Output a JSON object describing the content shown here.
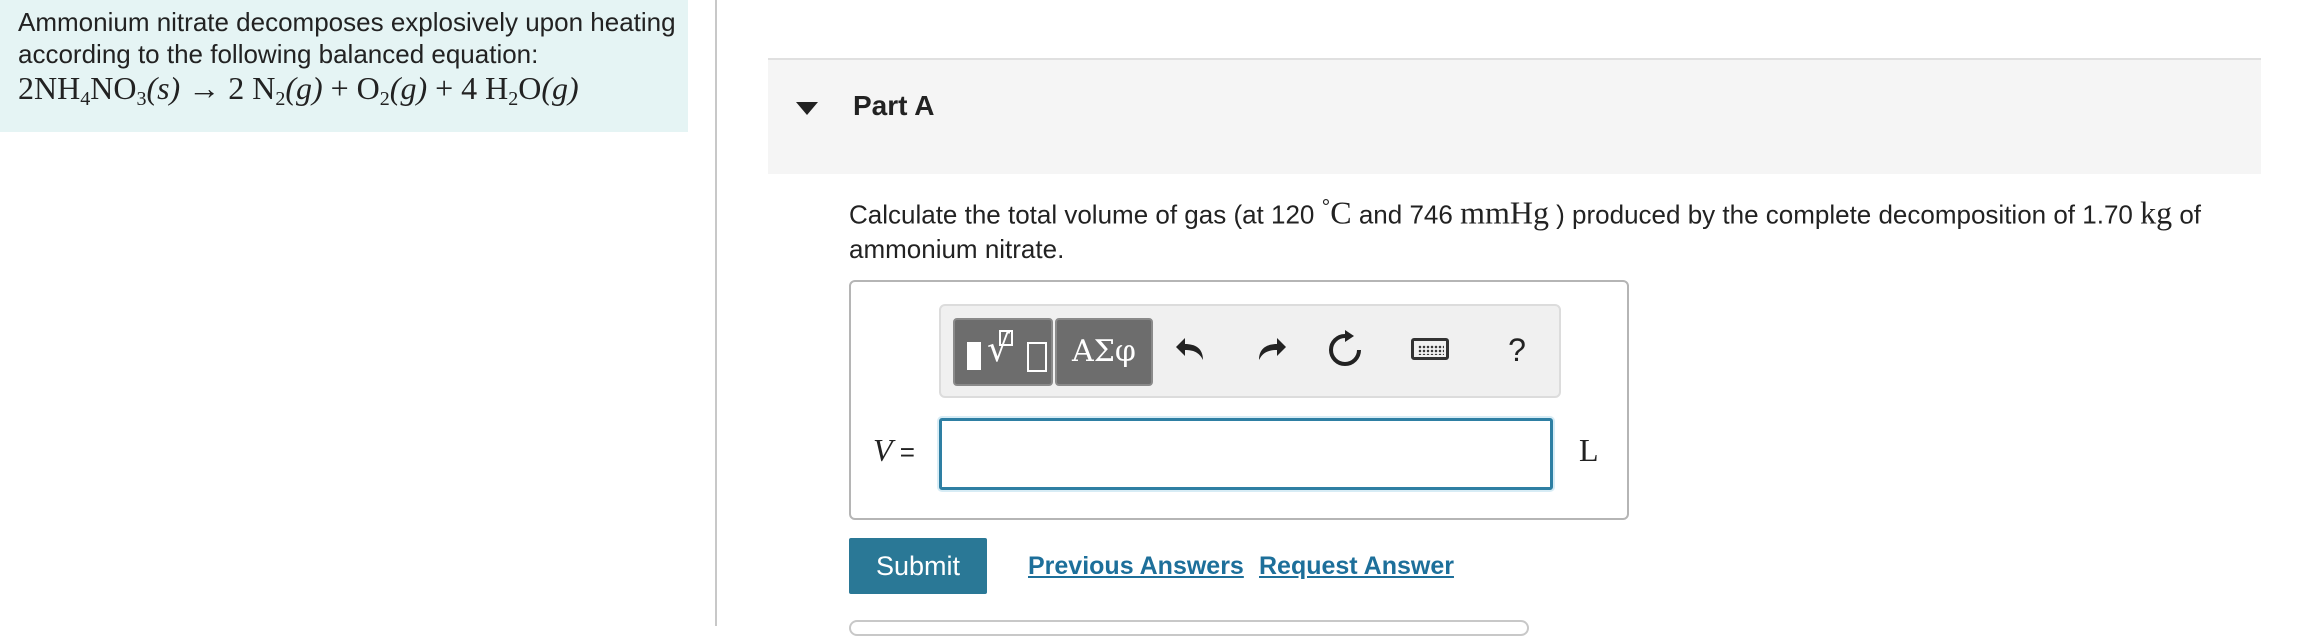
{
  "intro": {
    "text": "Ammonium nitrate decomposes explosively upon heating according to the following balanced equation:",
    "equation": {
      "reactant": "2NH",
      "reactant_sub1": "4",
      "reactant_mid": "NO",
      "reactant_sub2": "3",
      "reactant_state": "(s)",
      "arrow": "→",
      "p1_coef": "2 N",
      "p1_sub": "2",
      "p1_state": "(g)",
      "plus1": "+",
      "p2_base": "O",
      "p2_sub": "2",
      "p2_state": "(g)",
      "plus2": "+",
      "p3_coef": "4 H",
      "p3_sub": "2",
      "p3_mid": "O",
      "p3_state": "(g)"
    }
  },
  "part": {
    "title": "Part A"
  },
  "question": {
    "t1": "Calculate the total volume of gas (at 120 ",
    "deg": "°",
    "unit_c": "C",
    "t2": " and 746 ",
    "unit_mmhg": "mmHg",
    "t3": " ) produced by the complete decomposition of 1.70 ",
    "unit_kg": "kg",
    "t4": " of ammonium nitrate."
  },
  "toolbar": {
    "templates_radical": "√",
    "greek_label": "ΑΣφ",
    "undo_glyph": "↶",
    "redo_glyph": "↷",
    "reset_glyph": "↻",
    "help_label": "?"
  },
  "answer": {
    "variable": "V",
    "equals": " =",
    "value": "",
    "unit": "L"
  },
  "actions": {
    "submit_label": "Submit",
    "previous_answers_label": "Previous Answers",
    "request_answer_label": "Request Answer"
  }
}
